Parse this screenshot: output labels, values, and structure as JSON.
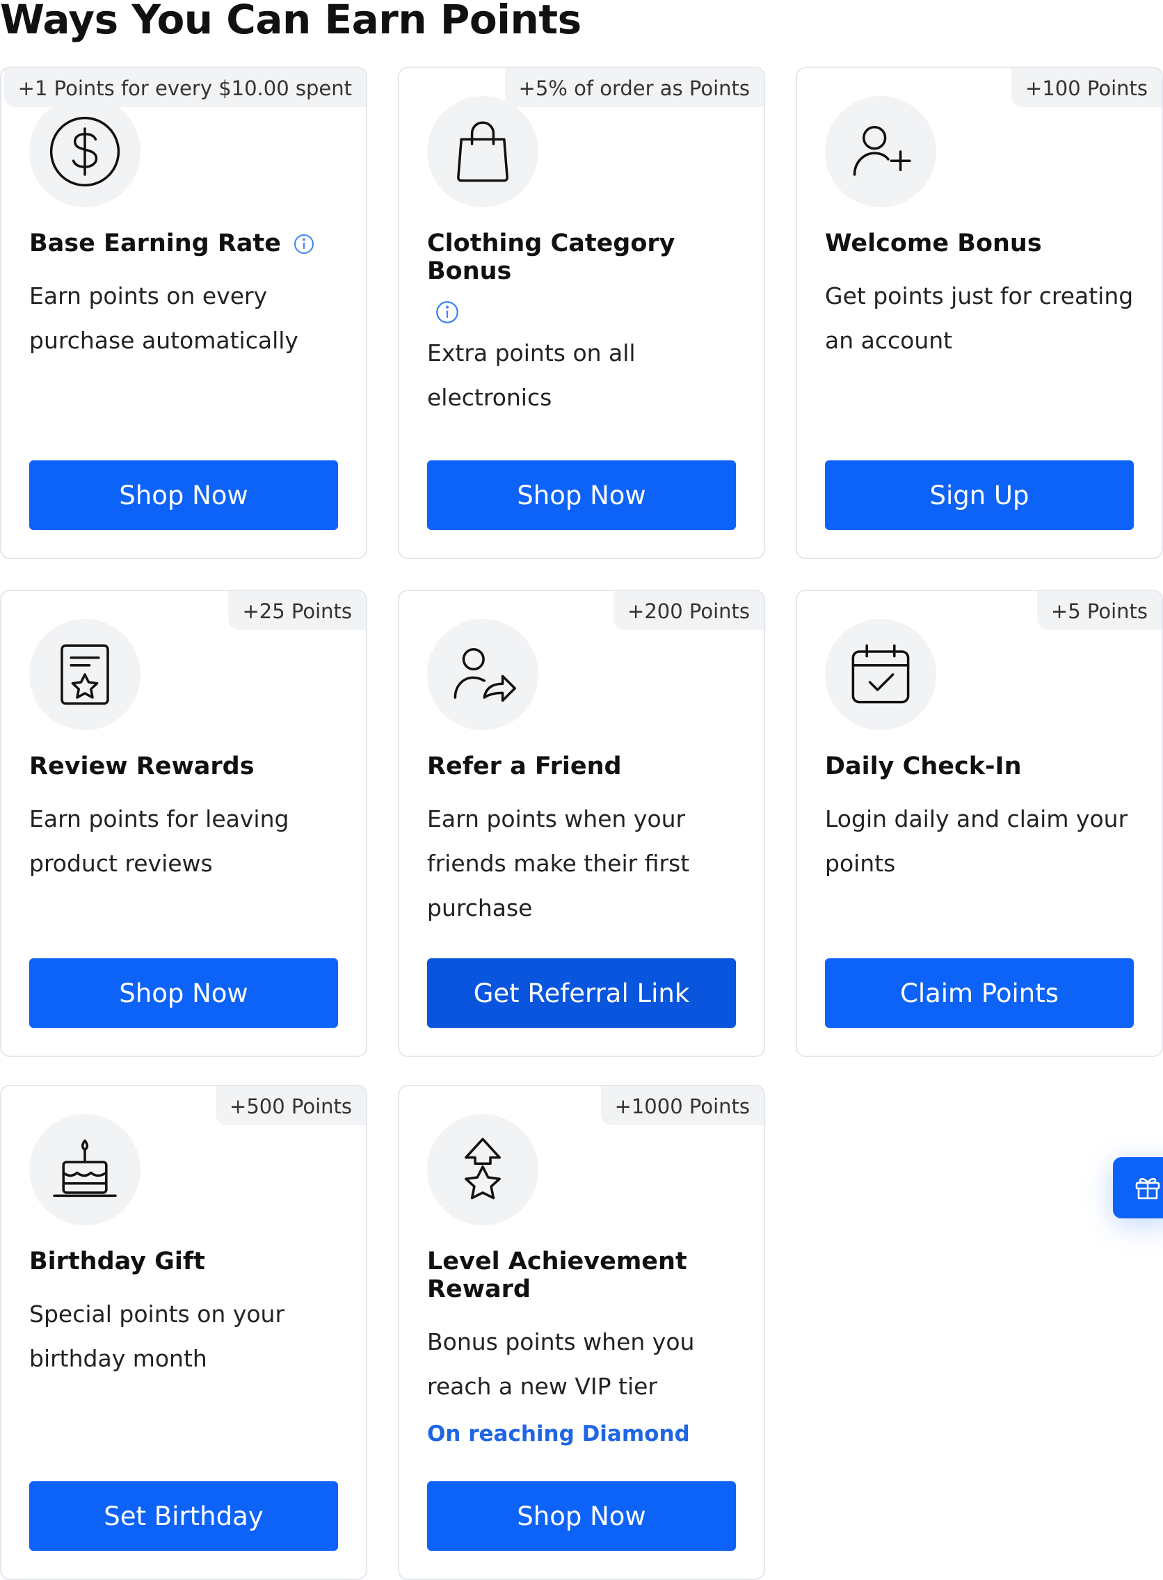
{
  "page": {
    "title": "Ways You Can Earn Points"
  },
  "colors": {
    "primary": "#0d63f8",
    "primary_dark": "#0a55dd",
    "highlight": "#1f66e6",
    "badge_bg": "#f2f3f5",
    "card_border": "#e4e8ee"
  },
  "cards": [
    {
      "badge": "+1 Points for every $10.00 spent",
      "icon": "dollar-circle-icon",
      "title": "Base Earning Rate",
      "description_lines": [
        "Earn points on every",
        "purchase automatically"
      ],
      "has_info": true,
      "button": "Shop Now"
    },
    {
      "badge": "+5% of order as Points",
      "icon": "shopping-bag-icon",
      "title_lines": [
        "Clothing Category",
        "Bonus"
      ],
      "description_lines": [
        "Extra points on all",
        "electronics"
      ],
      "has_info": true,
      "button": "Shop Now"
    },
    {
      "badge": "+100 Points",
      "icon": "user-plus-icon",
      "title": "Welcome Bonus",
      "description_lines": [
        "Get points just for creating",
        "an account"
      ],
      "button": "Sign Up"
    },
    {
      "badge": "+25 Points",
      "icon": "review-star-icon",
      "title": "Review Rewards",
      "description_lines": [
        "Earn points for leaving",
        "product reviews"
      ],
      "button": "Shop Now"
    },
    {
      "badge": "+200 Points",
      "icon": "user-share-icon",
      "title": "Refer a Friend",
      "description_lines": [
        "Earn points when your",
        "friends make their first",
        "purchase"
      ],
      "button": "Get Referral Link"
    },
    {
      "badge": "+5 Points",
      "icon": "calendar-check-icon",
      "title": "Daily Check-In",
      "description_lines": [
        "Login daily and claim your",
        "points"
      ],
      "button": "Claim Points"
    },
    {
      "badge": "+500 Points",
      "icon": "birthday-cake-icon",
      "title": "Birthday Gift",
      "description_lines": [
        "Special points on your",
        "birthday month"
      ],
      "button": "Set Birthday"
    },
    {
      "badge": "+1000 Points",
      "icon": "level-up-star-icon",
      "title_lines": [
        "Level Achievement",
        "Reward"
      ],
      "description_lines": [
        "Bonus points when you",
        "reach a new VIP tier"
      ],
      "highlight": "On reaching Diamond",
      "button": "Shop Now"
    }
  ],
  "floating_button": {
    "icon": "gift-icon"
  }
}
